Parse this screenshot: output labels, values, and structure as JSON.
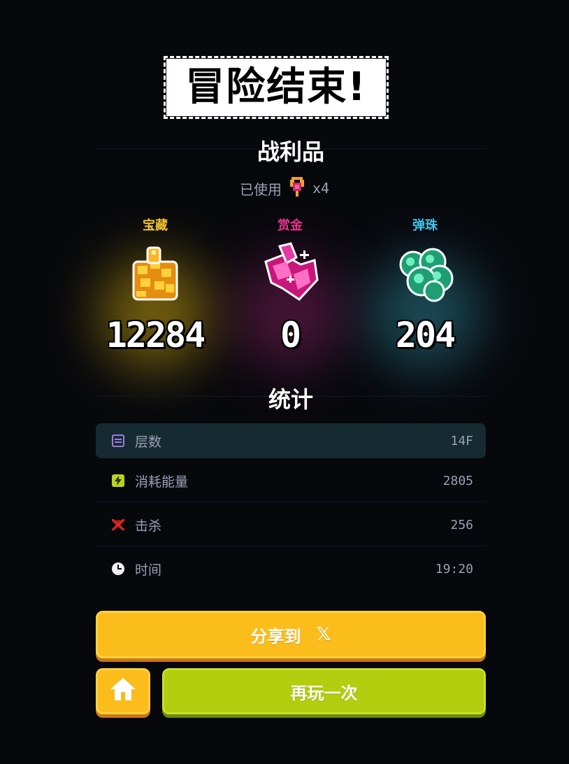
{
  "header": {
    "title": "冒险结束!"
  },
  "loot": {
    "section_title": "战利品",
    "used_label": "已使用",
    "used_count": "x4",
    "items": [
      {
        "label": "宝藏",
        "value": "12284",
        "color": "#f3c430",
        "glow": "#c9a20f",
        "icon": "gold-coins-icon"
      },
      {
        "label": "赏金",
        "value": "0",
        "color": "#e4338a",
        "glow": "#7a1f5a",
        "icon": "pink-gem-icon"
      },
      {
        "label": "弹珠",
        "value": "204",
        "color": "#41c2e8",
        "glow": "#2c7f92",
        "icon": "green-orbs-icon"
      }
    ]
  },
  "stats": {
    "section_title": "统计",
    "rows": [
      {
        "label": "层数",
        "value": "14F",
        "icon": "floor-icon",
        "icon_color": "#9b7be0"
      },
      {
        "label": "消耗能量",
        "value": "2805",
        "icon": "energy-icon",
        "icon_color": "#b8d31a"
      },
      {
        "label": "击杀",
        "value": "256",
        "icon": "skull-crossbones-icon",
        "icon_color": "#d8251f"
      },
      {
        "label": "时间",
        "value": "19:20",
        "icon": "clock-icon",
        "icon_color": "#ffffff"
      }
    ]
  },
  "buttons": {
    "share_label": "分享到",
    "share_x": "𝕏",
    "home_icon": "home-icon",
    "play_again_label": "再玩一次"
  },
  "colors": {
    "accent_yellow": "#fbbd1b",
    "accent_green": "#b3cd0f",
    "background": "#07080c"
  }
}
